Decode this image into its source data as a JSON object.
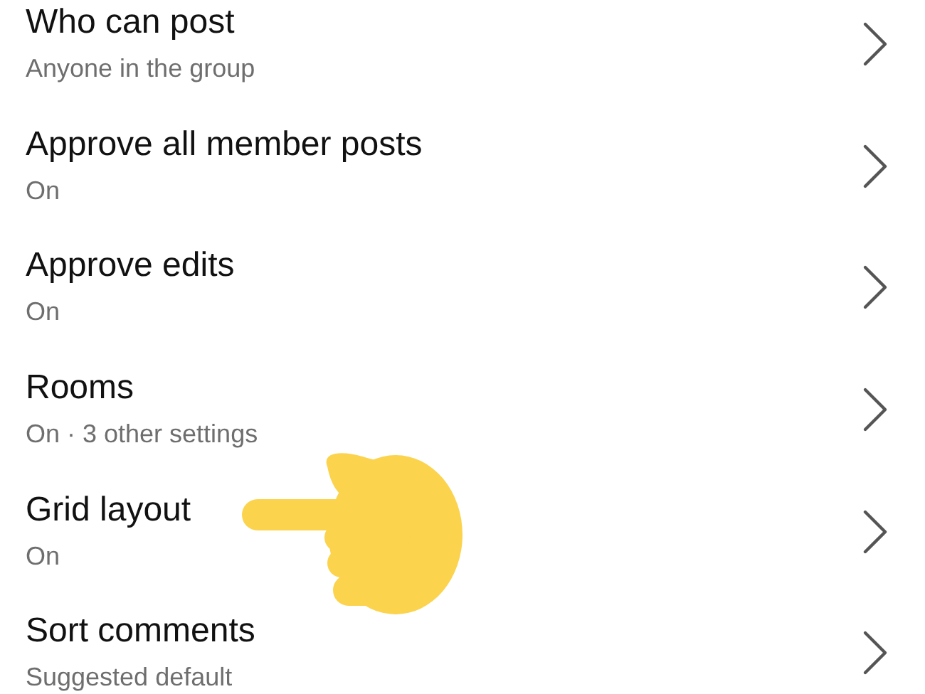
{
  "settings": [
    {
      "title": "Who can post",
      "subtitle": "Anyone in the group"
    },
    {
      "title": "Approve all member posts",
      "subtitle": "On"
    },
    {
      "title": "Approve edits",
      "subtitle": "On"
    },
    {
      "title": "Rooms",
      "subtitle": "On · 3 other settings"
    },
    {
      "title": "Grid layout",
      "subtitle": "On"
    },
    {
      "title": "Sort comments",
      "subtitle": "Suggested default"
    }
  ]
}
